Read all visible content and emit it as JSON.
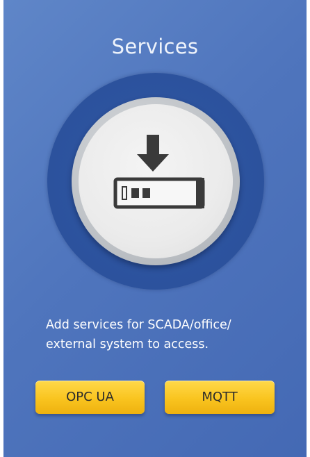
{
  "panel": {
    "title": "Services",
    "icon": "download-to-device-icon",
    "description_line1": "Add services for SCADA/office/",
    "description_line2": "external system to access."
  },
  "buttons": {
    "opc_ua_label": "OPC UA",
    "mqtt_label": "MQTT"
  },
  "colors": {
    "background": "#4f75bd",
    "ring": "#2c529d",
    "button": "#f9c41f",
    "icon": "#3a3a3a"
  }
}
